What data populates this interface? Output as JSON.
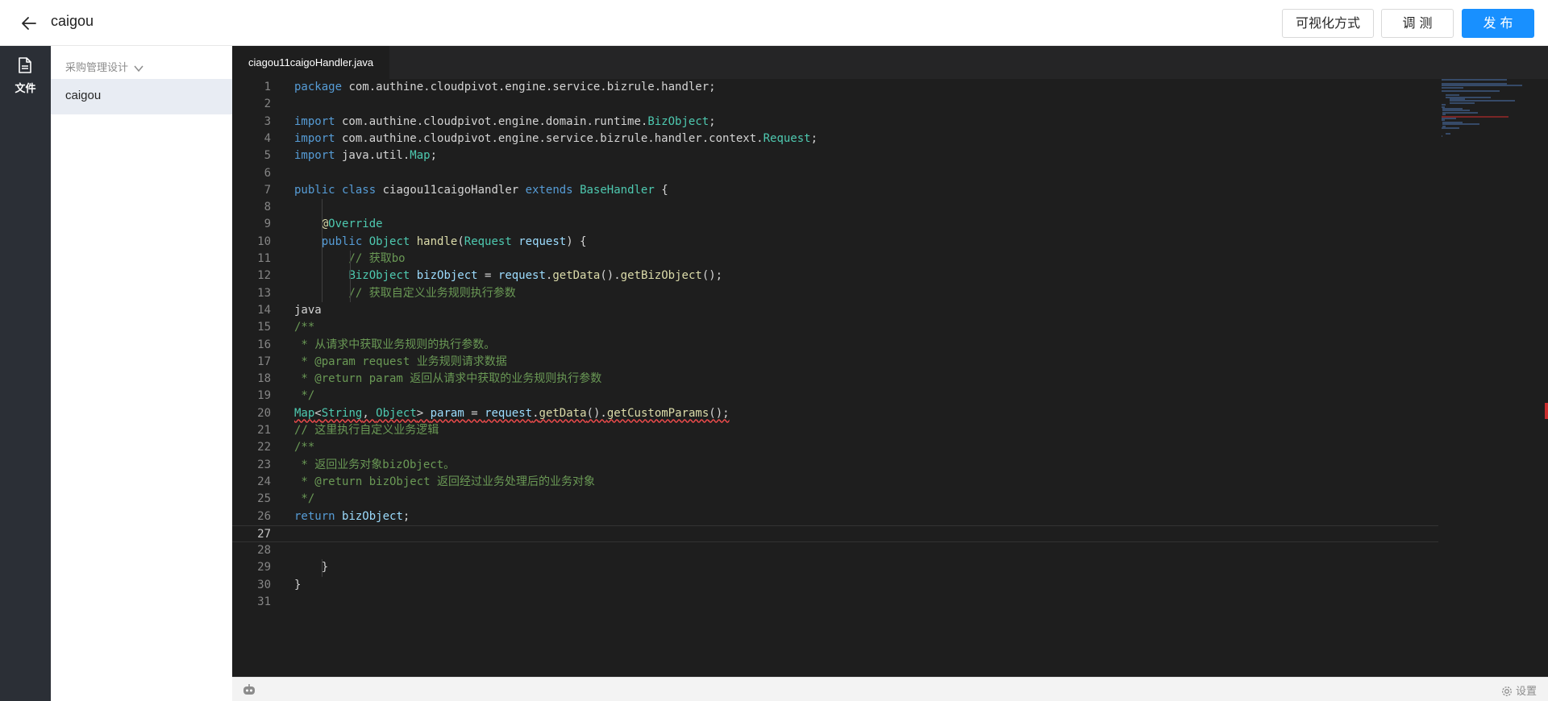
{
  "header": {
    "title": "caigou",
    "visual_btn": "可视化方式",
    "debug_btn": "调 测",
    "publish_btn": "发 布",
    "accent": "#1890ff"
  },
  "rail": {
    "file_label": "文件",
    "icon": "file-icon"
  },
  "tree": {
    "group": "采购管理设计",
    "file": "caigou"
  },
  "editor": {
    "tab": "ciagou11caigoHandler.java",
    "lines": [
      {
        "n": "1",
        "t": "package com.authine.cloudpivot.engine.service.bizrule.handler;"
      },
      {
        "n": "2",
        "t": ""
      },
      {
        "n": "3",
        "t": "import com.authine.cloudpivot.engine.domain.runtime.BizObject;"
      },
      {
        "n": "4",
        "t": "import com.authine.cloudpivot.engine.service.bizrule.handler.context.Request;"
      },
      {
        "n": "5",
        "t": "import java.util.Map;"
      },
      {
        "n": "6",
        "t": ""
      },
      {
        "n": "7",
        "t": "public class ciagou11caigoHandler extends BaseHandler {"
      },
      {
        "n": "8",
        "t": ""
      },
      {
        "n": "9",
        "t": "    @Override"
      },
      {
        "n": "10",
        "t": "    public Object handle(Request request) {"
      },
      {
        "n": "11",
        "t": "        // 获取bo"
      },
      {
        "n": "12",
        "t": "        BizObject bizObject = request.getData().getBizObject();"
      },
      {
        "n": "13",
        "t": "        // 获取自定义业务规则执行参数"
      },
      {
        "n": "14",
        "t": "java"
      },
      {
        "n": "15",
        "t": "/**"
      },
      {
        "n": "16",
        "t": " * 从请求中获取业务规则的执行参数。"
      },
      {
        "n": "17",
        "t": " * @param request 业务规则请求数据"
      },
      {
        "n": "18",
        "t": " * @return param 返回从请求中获取的业务规则执行参数"
      },
      {
        "n": "19",
        "t": " */"
      },
      {
        "n": "20",
        "t": "Map<String, Object> param = request.getData().getCustomParams();"
      },
      {
        "n": "21",
        "t": "// 这里执行自定义业务逻辑"
      },
      {
        "n": "22",
        "t": "/**"
      },
      {
        "n": "23",
        "t": " * 返回业务对象bizObject。"
      },
      {
        "n": "24",
        "t": " * @return bizObject 返回经过业务处理后的业务对象"
      },
      {
        "n": "25",
        "t": " */"
      },
      {
        "n": "26",
        "t": "return bizObject;"
      },
      {
        "n": "27",
        "t": ""
      },
      {
        "n": "28",
        "t": ""
      },
      {
        "n": "29",
        "t": "    }"
      },
      {
        "n": "30",
        "t": "}"
      },
      {
        "n": "31",
        "t": ""
      }
    ],
    "current_line": "27"
  },
  "status": {
    "settings": "设置",
    "settings_icon": "gear-icon",
    "bot_icon": "robot-icon"
  }
}
